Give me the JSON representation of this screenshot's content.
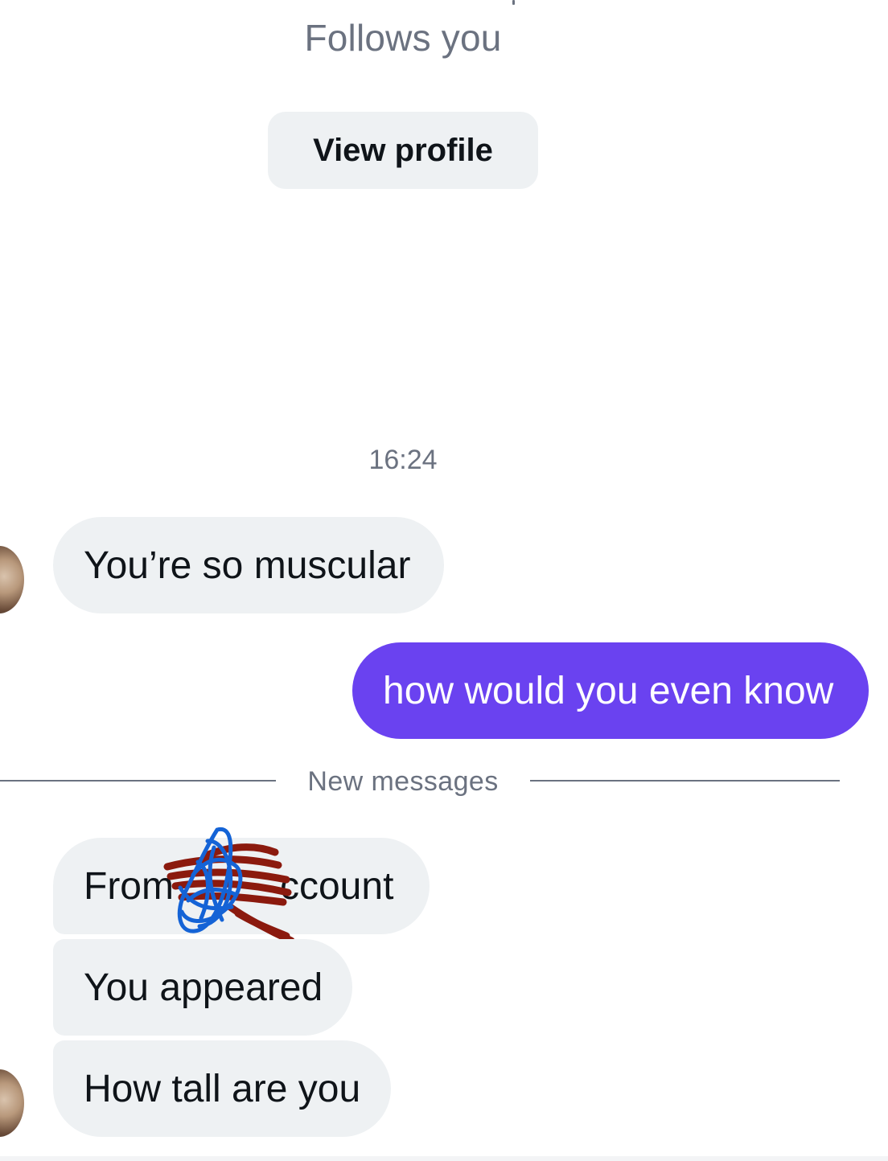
{
  "profile": {
    "follows_you": "Follows you",
    "view_profile_label": "View profile"
  },
  "conversation": {
    "timestamp": "16:24",
    "messages_before": [
      {
        "sender": "them",
        "text": "You’re so muscular"
      },
      {
        "sender": "me",
        "text": "how would you even know"
      }
    ],
    "new_messages_label": "New messages",
    "messages_after": [
      {
        "sender": "them",
        "text": "From ccount",
        "redacted": true
      },
      {
        "sender": "them",
        "text": "You appeared"
      },
      {
        "sender": "them",
        "text": "How tall are you"
      }
    ]
  },
  "colors": {
    "outgoing_bubble": "#6a42f0",
    "incoming_bubble": "#eef1f3",
    "secondary_text": "#6b7280",
    "scribble_red": "#8b1a0e",
    "scribble_blue": "#1463d6"
  }
}
